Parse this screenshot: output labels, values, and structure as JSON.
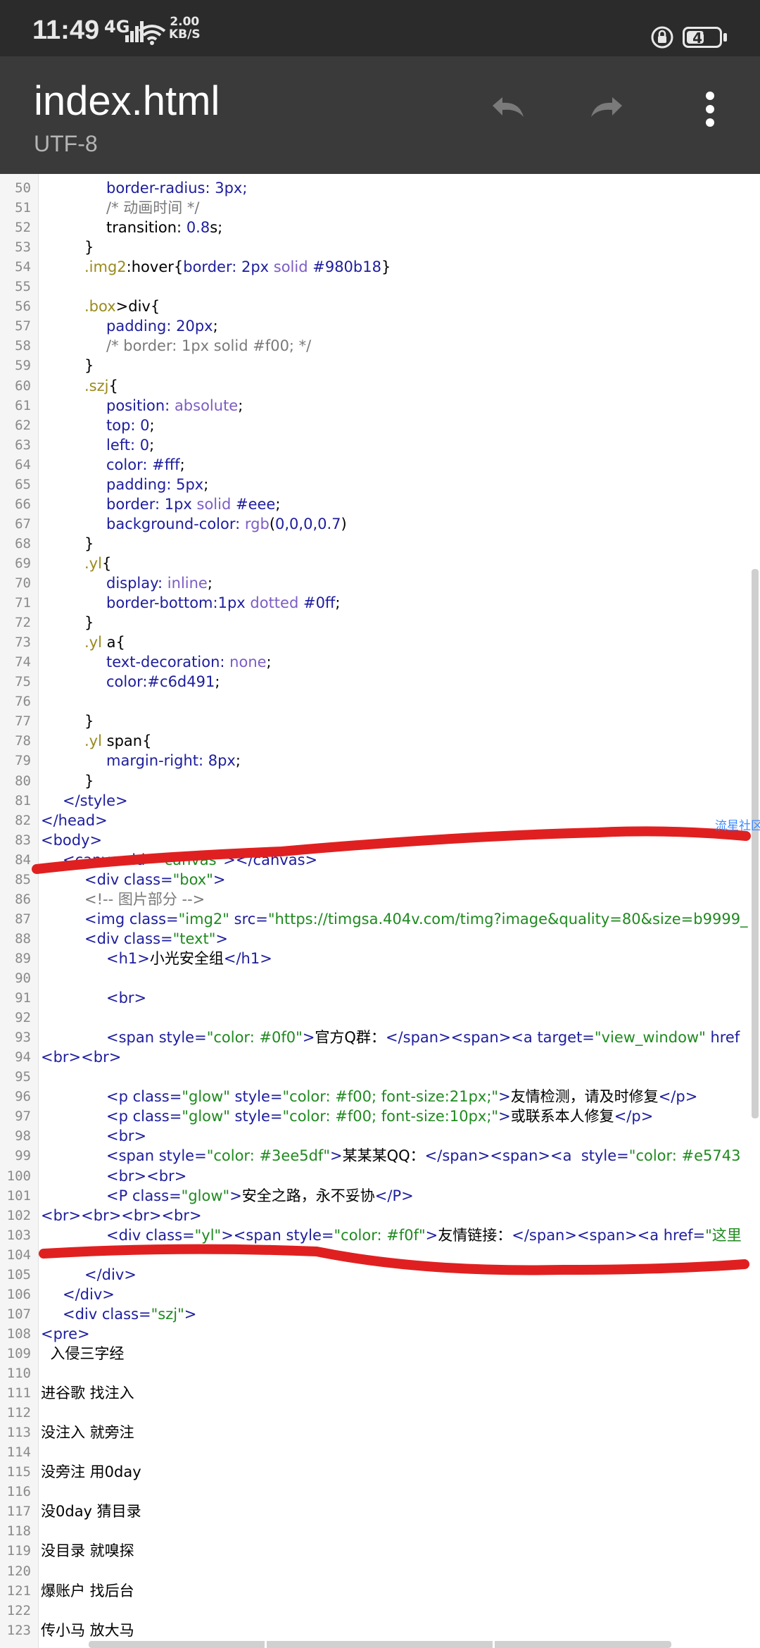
{
  "status_bar": {
    "time": "11:49",
    "network": "4G",
    "speed_value": "2.00",
    "speed_unit": "KB/S",
    "battery": "47"
  },
  "app_bar": {
    "title": "index.html",
    "subtitle": "UTF-8",
    "icons": [
      "undo-icon",
      "redo-icon",
      "more-vert-icon"
    ]
  },
  "overlay_link": "流星社区",
  "editor": {
    "lines": [
      {
        "n": "50",
        "indent": 3,
        "tokens": [
          [
            "border-radius: 3px;",
            "prop"
          ]
        ]
      },
      {
        "n": "51",
        "indent": 3,
        "tokens": [
          [
            "/* 动画时间 */",
            "cmt"
          ]
        ]
      },
      {
        "n": "52",
        "indent": 3,
        "tokens": [
          [
            "transition: ",
            "pun"
          ],
          [
            "0.8",
            "num"
          ],
          [
            "s;",
            "pun"
          ]
        ]
      },
      {
        "n": "53",
        "indent": 2,
        "tokens": [
          [
            "}",
            "pun"
          ]
        ]
      },
      {
        "n": "54",
        "indent": 2,
        "tokens": [
          [
            ".img2",
            "sel"
          ],
          [
            ":hover{",
            "pun"
          ],
          [
            "border: ",
            "prop"
          ],
          [
            "2px ",
            "num"
          ],
          [
            "solid ",
            "kw"
          ],
          [
            "#980b18",
            "num"
          ],
          [
            "}",
            "pun"
          ]
        ]
      },
      {
        "n": "55",
        "indent": 0,
        "tokens": []
      },
      {
        "n": "56",
        "indent": 2,
        "tokens": [
          [
            ".box",
            "sel"
          ],
          [
            ">div{",
            "pun"
          ]
        ]
      },
      {
        "n": "57",
        "indent": 3,
        "tokens": [
          [
            "padding: ",
            "prop"
          ],
          [
            "20px",
            "num"
          ],
          [
            ";",
            "pun"
          ]
        ]
      },
      {
        "n": "58",
        "indent": 3,
        "tokens": [
          [
            "/* border: 1px solid #f00; */",
            "cmt"
          ]
        ]
      },
      {
        "n": "59",
        "indent": 2,
        "tokens": [
          [
            "}",
            "pun"
          ]
        ]
      },
      {
        "n": "60",
        "indent": 2,
        "tokens": [
          [
            ".szj",
            "sel"
          ],
          [
            "{",
            "pun"
          ]
        ]
      },
      {
        "n": "61",
        "indent": 3,
        "tokens": [
          [
            "position: ",
            "prop"
          ],
          [
            "absolute",
            "kw"
          ],
          [
            ";",
            "pun"
          ]
        ]
      },
      {
        "n": "62",
        "indent": 3,
        "tokens": [
          [
            "top: ",
            "prop"
          ],
          [
            "0",
            "num"
          ],
          [
            ";",
            "pun"
          ]
        ]
      },
      {
        "n": "63",
        "indent": 3,
        "tokens": [
          [
            "left: ",
            "prop"
          ],
          [
            "0",
            "num"
          ],
          [
            ";",
            "pun"
          ]
        ]
      },
      {
        "n": "64",
        "indent": 3,
        "tokens": [
          [
            "color: ",
            "prop"
          ],
          [
            "#fff",
            "num"
          ],
          [
            ";",
            "pun"
          ]
        ]
      },
      {
        "n": "65",
        "indent": 3,
        "tokens": [
          [
            "padding: ",
            "prop"
          ],
          [
            "5px",
            "num"
          ],
          [
            ";",
            "pun"
          ]
        ]
      },
      {
        "n": "66",
        "indent": 3,
        "tokens": [
          [
            "border: ",
            "prop"
          ],
          [
            "1px ",
            "num"
          ],
          [
            "solid ",
            "kw"
          ],
          [
            "#eee",
            "num"
          ],
          [
            ";",
            "pun"
          ]
        ]
      },
      {
        "n": "67",
        "indent": 3,
        "tokens": [
          [
            "background-color: ",
            "prop"
          ],
          [
            "rgb",
            "kw"
          ],
          [
            "(",
            "pun"
          ],
          [
            "0,0,0,0.7",
            "num"
          ],
          [
            ")",
            "pun"
          ]
        ]
      },
      {
        "n": "68",
        "indent": 2,
        "tokens": [
          [
            "}",
            "pun"
          ]
        ]
      },
      {
        "n": "69",
        "indent": 2,
        "tokens": [
          [
            ".yl",
            "sel"
          ],
          [
            "{",
            "pun"
          ]
        ]
      },
      {
        "n": "70",
        "indent": 3,
        "tokens": [
          [
            "display: ",
            "prop"
          ],
          [
            "inline",
            "kw"
          ],
          [
            ";",
            "pun"
          ]
        ]
      },
      {
        "n": "71",
        "indent": 3,
        "tokens": [
          [
            "border-bottom:",
            "prop"
          ],
          [
            "1px ",
            "num"
          ],
          [
            "dotted ",
            "kw"
          ],
          [
            "#0ff",
            "num"
          ],
          [
            ";",
            "pun"
          ]
        ]
      },
      {
        "n": "72",
        "indent": 2,
        "tokens": [
          [
            "}",
            "pun"
          ]
        ]
      },
      {
        "n": "73",
        "indent": 2,
        "tokens": [
          [
            ".yl ",
            "sel"
          ],
          [
            "a{",
            "pun"
          ]
        ]
      },
      {
        "n": "74",
        "indent": 3,
        "tokens": [
          [
            "text-decoration: ",
            "prop"
          ],
          [
            "none",
            "kw"
          ],
          [
            ";",
            "pun"
          ]
        ]
      },
      {
        "n": "75",
        "indent": 3,
        "tokens": [
          [
            "color:",
            "prop"
          ],
          [
            "#c6d491",
            "num"
          ],
          [
            ";",
            "pun"
          ]
        ]
      },
      {
        "n": "76",
        "indent": 0,
        "tokens": []
      },
      {
        "n": "77",
        "indent": 2,
        "tokens": [
          [
            "}",
            "pun"
          ]
        ]
      },
      {
        "n": "78",
        "indent": 2,
        "tokens": [
          [
            ".yl ",
            "sel"
          ],
          [
            "span{",
            "pun"
          ]
        ]
      },
      {
        "n": "79",
        "indent": 3,
        "tokens": [
          [
            "margin-right: ",
            "prop"
          ],
          [
            "8px",
            "num"
          ],
          [
            ";",
            "pun"
          ]
        ]
      },
      {
        "n": "80",
        "indent": 2,
        "tokens": [
          [
            "}",
            "pun"
          ]
        ]
      },
      {
        "n": "81",
        "indent": 1,
        "tokens": [
          [
            "</style>",
            "tag"
          ]
        ]
      },
      {
        "n": "82",
        "indent": 0,
        "tokens": [
          [
            "</head>",
            "tag"
          ]
        ]
      },
      {
        "n": "83",
        "indent": 0,
        "tokens": [
          [
            "<body>",
            "tag"
          ]
        ]
      },
      {
        "n": "84",
        "indent": 1,
        "tokens": [
          [
            "<canvas ",
            "tag"
          ],
          [
            "id=",
            "attr"
          ],
          [
            "\"canvas\"",
            "str"
          ],
          [
            "></canvas>",
            "tag"
          ]
        ]
      },
      {
        "n": "85",
        "indent": 2,
        "tokens": [
          [
            "<div ",
            "tag"
          ],
          [
            "class=",
            "attr"
          ],
          [
            "\"box\"",
            "str"
          ],
          [
            ">",
            "tag"
          ]
        ]
      },
      {
        "n": "86",
        "indent": 2,
        "tokens": [
          [
            "<!-- 图片部分 -->",
            "cmt"
          ]
        ]
      },
      {
        "n": "87",
        "indent": 2,
        "tokens": [
          [
            "<img ",
            "tag"
          ],
          [
            "class=",
            "attr"
          ],
          [
            "\"img2\" ",
            "str"
          ],
          [
            "src=",
            "attr"
          ],
          [
            "\"https://timgsa.404v.com/timg?image&quality=80&size=b9999_",
            "str"
          ]
        ]
      },
      {
        "n": "88",
        "indent": 2,
        "tokens": [
          [
            "<div ",
            "tag"
          ],
          [
            "class=",
            "attr"
          ],
          [
            "\"text\"",
            "str"
          ],
          [
            ">",
            "tag"
          ]
        ]
      },
      {
        "n": "89",
        "indent": 3,
        "tokens": [
          [
            "<h1>",
            "tag"
          ],
          [
            "小光安全组",
            "pun"
          ],
          [
            "</h1>",
            "tag"
          ]
        ]
      },
      {
        "n": "90",
        "indent": 0,
        "tokens": []
      },
      {
        "n": "91",
        "indent": 3,
        "tokens": [
          [
            "<br>",
            "tag"
          ]
        ]
      },
      {
        "n": "92",
        "indent": 0,
        "tokens": []
      },
      {
        "n": "93",
        "indent": 3,
        "tokens": [
          [
            "<span ",
            "tag"
          ],
          [
            "style=",
            "attr"
          ],
          [
            "\"color: #0f0\"",
            "str"
          ],
          [
            ">",
            "tag"
          ],
          [
            "官方Q群：",
            "pun"
          ],
          [
            "</span><span><a ",
            "tag"
          ],
          [
            "target=",
            "attr"
          ],
          [
            "\"view_window\" ",
            "str"
          ],
          [
            "href",
            "attr"
          ]
        ]
      },
      {
        "n": "94",
        "indent": 0,
        "tokens": [
          [
            "<br><br>",
            "tag"
          ]
        ]
      },
      {
        "n": "95",
        "indent": 0,
        "tokens": []
      },
      {
        "n": "96",
        "indent": 3,
        "tokens": [
          [
            "<p ",
            "tag"
          ],
          [
            "class=",
            "attr"
          ],
          [
            "\"glow\" ",
            "str"
          ],
          [
            "style=",
            "attr"
          ],
          [
            "\"color: #f00; font-size:21px;\"",
            "str"
          ],
          [
            ">",
            "tag"
          ],
          [
            "友情检测，请及时修复",
            "pun"
          ],
          [
            "</p>",
            "tag"
          ]
        ]
      },
      {
        "n": "97",
        "indent": 3,
        "tokens": [
          [
            "<p ",
            "tag"
          ],
          [
            "class=",
            "attr"
          ],
          [
            "\"glow\" ",
            "str"
          ],
          [
            "style=",
            "attr"
          ],
          [
            "\"color: #f00; font-size:10px;\"",
            "str"
          ],
          [
            ">",
            "tag"
          ],
          [
            "或联系本人修复",
            "pun"
          ],
          [
            "</p>",
            "tag"
          ]
        ]
      },
      {
        "n": "98",
        "indent": 3,
        "tokens": [
          [
            "<br>",
            "tag"
          ]
        ]
      },
      {
        "n": "99",
        "indent": 3,
        "tokens": [
          [
            "<span ",
            "tag"
          ],
          [
            "style=",
            "attr"
          ],
          [
            "\"color: #3ee5df\"",
            "str"
          ],
          [
            ">",
            "tag"
          ],
          [
            "某某某QQ：",
            "pun"
          ],
          [
            "</span><span><a  ",
            "tag"
          ],
          [
            "style=",
            "attr"
          ],
          [
            "\"color: #e5743",
            "str"
          ]
        ]
      },
      {
        "n": "100",
        "indent": 3,
        "tokens": [
          [
            "<br><br>",
            "tag"
          ]
        ]
      },
      {
        "n": "101",
        "indent": 3,
        "tokens": [
          [
            "<P ",
            "tag"
          ],
          [
            "class=",
            "attr"
          ],
          [
            "\"glow\"",
            "str"
          ],
          [
            ">",
            "tag"
          ],
          [
            "安全之路，永不妥协",
            "pun"
          ],
          [
            "</P>",
            "tag"
          ]
        ]
      },
      {
        "n": "102",
        "indent": 0,
        "tokens": [
          [
            "<br><br><br><br>",
            "tag"
          ]
        ]
      },
      {
        "n": "103",
        "indent": 3,
        "tokens": [
          [
            "<div ",
            "tag"
          ],
          [
            "class=",
            "attr"
          ],
          [
            "\"yl\"",
            "str"
          ],
          [
            "><span ",
            "tag"
          ],
          [
            "style=",
            "attr"
          ],
          [
            "\"color: #f0f\"",
            "str"
          ],
          [
            ">",
            "tag"
          ],
          [
            "友情链接：",
            "pun"
          ],
          [
            "</span><span><a ",
            "tag"
          ],
          [
            "href=",
            "attr"
          ],
          [
            "\"这里",
            "str"
          ]
        ]
      },
      {
        "n": "104",
        "indent": 0,
        "tokens": []
      },
      {
        "n": "105",
        "indent": 2,
        "tokens": [
          [
            "</div>",
            "tag"
          ]
        ]
      },
      {
        "n": "106",
        "indent": 1,
        "tokens": [
          [
            "</div>",
            "tag"
          ]
        ]
      },
      {
        "n": "107",
        "indent": 1,
        "tokens": [
          [
            "<div ",
            "tag"
          ],
          [
            "class=",
            "attr"
          ],
          [
            "\"szj\"",
            "str"
          ],
          [
            ">",
            "tag"
          ]
        ]
      },
      {
        "n": "108",
        "indent": 0,
        "tokens": [
          [
            "<pre>",
            "tag"
          ]
        ]
      },
      {
        "n": "109",
        "indent": 0,
        "tokens": [
          [
            "  入侵三字经",
            "pun"
          ]
        ]
      },
      {
        "n": "110",
        "indent": 0,
        "tokens": []
      },
      {
        "n": "111",
        "indent": 0,
        "tokens": [
          [
            "进谷歌 找注入",
            "pun"
          ]
        ]
      },
      {
        "n": "112",
        "indent": 0,
        "tokens": []
      },
      {
        "n": "113",
        "indent": 0,
        "tokens": [
          [
            "没注入 就旁注",
            "pun"
          ]
        ]
      },
      {
        "n": "114",
        "indent": 0,
        "tokens": []
      },
      {
        "n": "115",
        "indent": 0,
        "tokens": [
          [
            "没旁注 用0day",
            "pun"
          ]
        ]
      },
      {
        "n": "116",
        "indent": 0,
        "tokens": []
      },
      {
        "n": "117",
        "indent": 0,
        "tokens": [
          [
            "没0day 猜目录",
            "pun"
          ]
        ]
      },
      {
        "n": "118",
        "indent": 0,
        "tokens": []
      },
      {
        "n": "119",
        "indent": 0,
        "tokens": [
          [
            "没目录 就嗅探",
            "pun"
          ]
        ]
      },
      {
        "n": "120",
        "indent": 0,
        "tokens": []
      },
      {
        "n": "121",
        "indent": 0,
        "tokens": [
          [
            "爆账户 找后台",
            "pun"
          ]
        ]
      },
      {
        "n": "122",
        "indent": 0,
        "tokens": []
      },
      {
        "n": "123",
        "indent": 0,
        "tokens": [
          [
            "传小马 放大马",
            "pun"
          ]
        ]
      }
    ]
  }
}
